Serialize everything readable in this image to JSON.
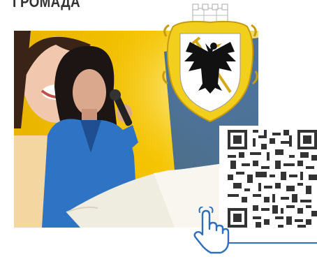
{
  "heading": "ГРОМАДА",
  "colors": {
    "photo_background": "#f5c400",
    "jacket": "#2f74c4",
    "emblem_gold": "#f2cf1c",
    "qr_dark": "#333333",
    "accent_line": "#2d6fbf"
  },
  "icons": [
    "coat-of-arms-icon",
    "qr-code-icon",
    "pointing-hand-icon"
  ]
}
